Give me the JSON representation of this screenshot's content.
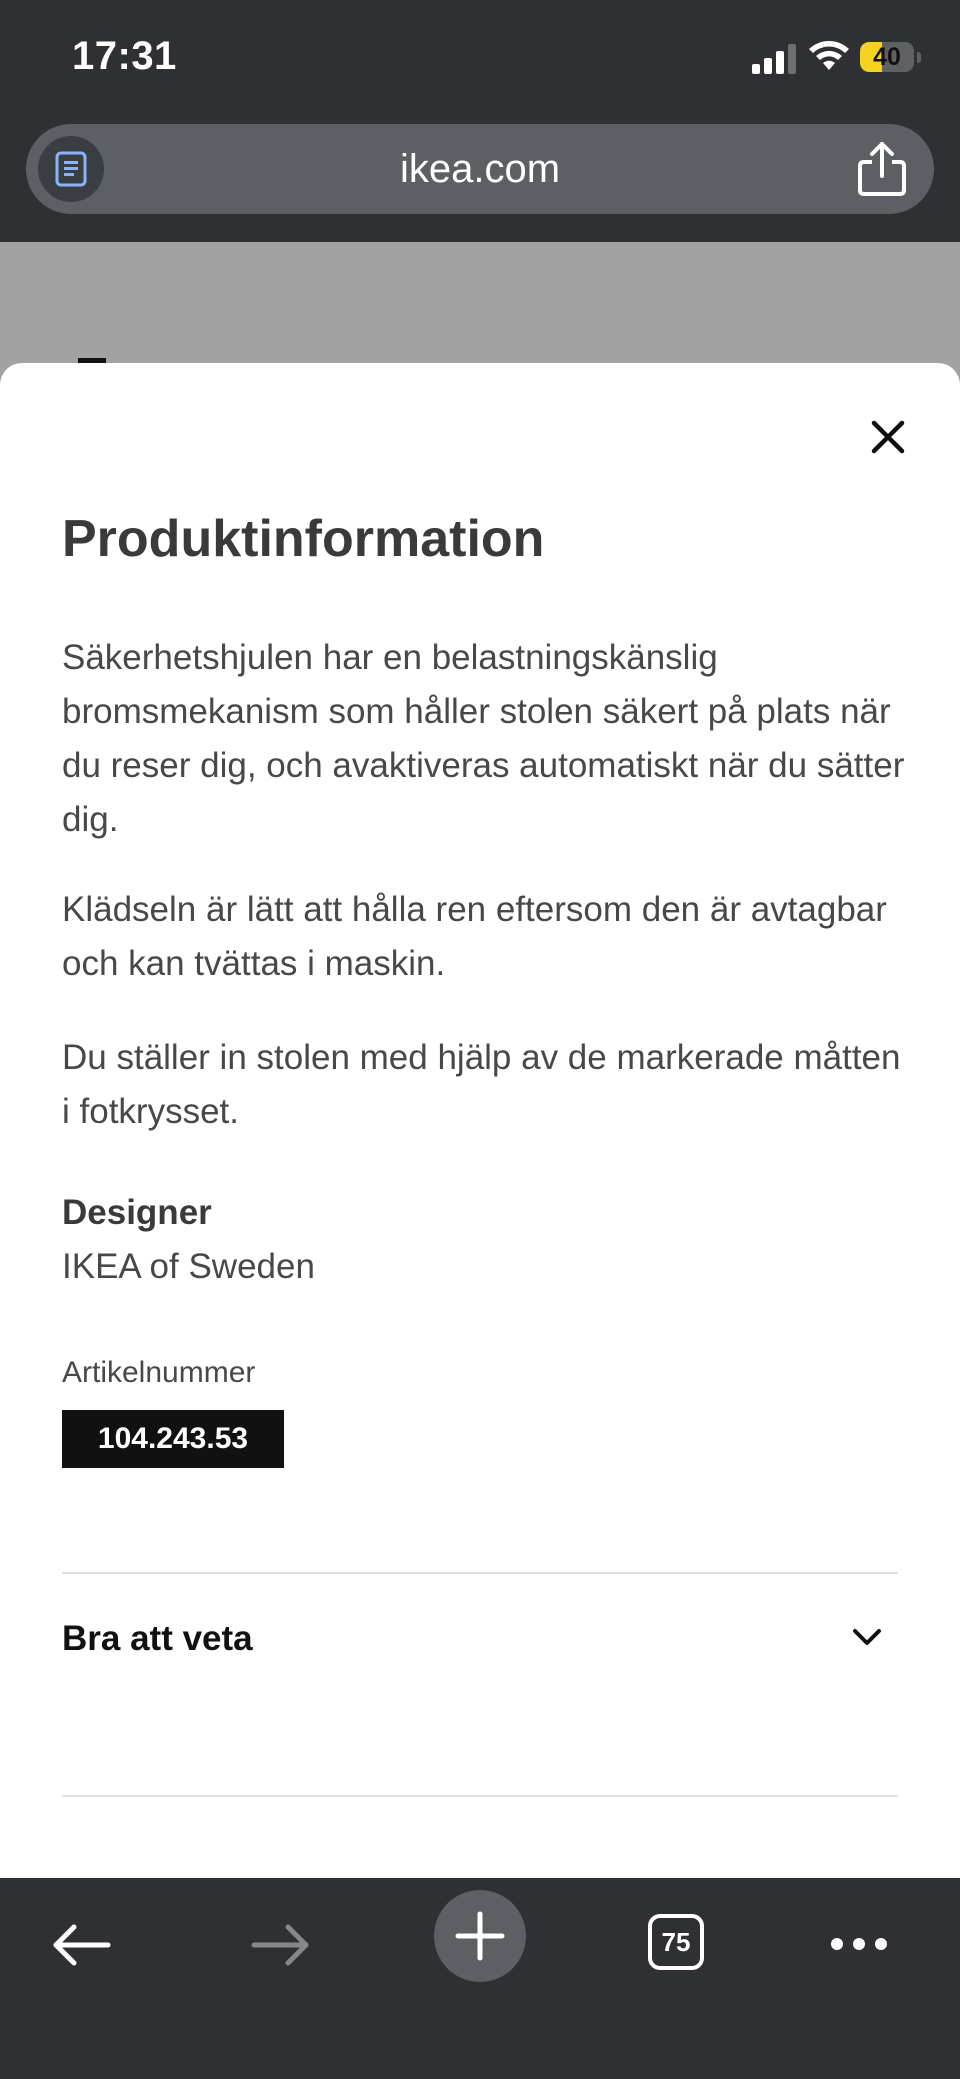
{
  "status_bar": {
    "time": "17:31",
    "battery_level": "40",
    "battery_fraction": 0.4,
    "icons": [
      "cellular-signal-icon",
      "wifi-icon",
      "battery-icon"
    ]
  },
  "browser": {
    "url": "ikea.com",
    "icons": [
      "reader-mode-icon",
      "share-icon"
    ]
  },
  "sheet": {
    "close_icon": "close-icon",
    "title": "Produktinformation",
    "paragraphs": [
      "Säkerhetshjulen har en belastningskänslig bromsmekanism som håller stolen säkert på plats när du reser dig, och avaktiveras automatiskt när du sätter dig.",
      "Klädseln är lätt att hålla ren eftersom den är avtagbar och kan tvättas i maskin.",
      "Du ställer in stolen med hjälp av de markerade måtten i fotkrysset."
    ],
    "designer_label": "Designer",
    "designer_value": "IKEA of Sweden",
    "article_label": "Artikelnummer",
    "article_number": "104.243.53",
    "accordion_label": "Bra att veta",
    "accordion_icon": "chevron-down-icon"
  },
  "toolbar": {
    "tab_count": "75",
    "icons": [
      "back-arrow-icon",
      "forward-arrow-icon",
      "plus-icon",
      "tabs-icon",
      "more-icon"
    ]
  },
  "colors": {
    "chrome_bg": "#2f3033",
    "url_bar_bg": "#5c5f63",
    "battery_yellow": "#f4d21e",
    "sheet_bg": "#ffffff",
    "article_badge_bg": "#111111"
  }
}
